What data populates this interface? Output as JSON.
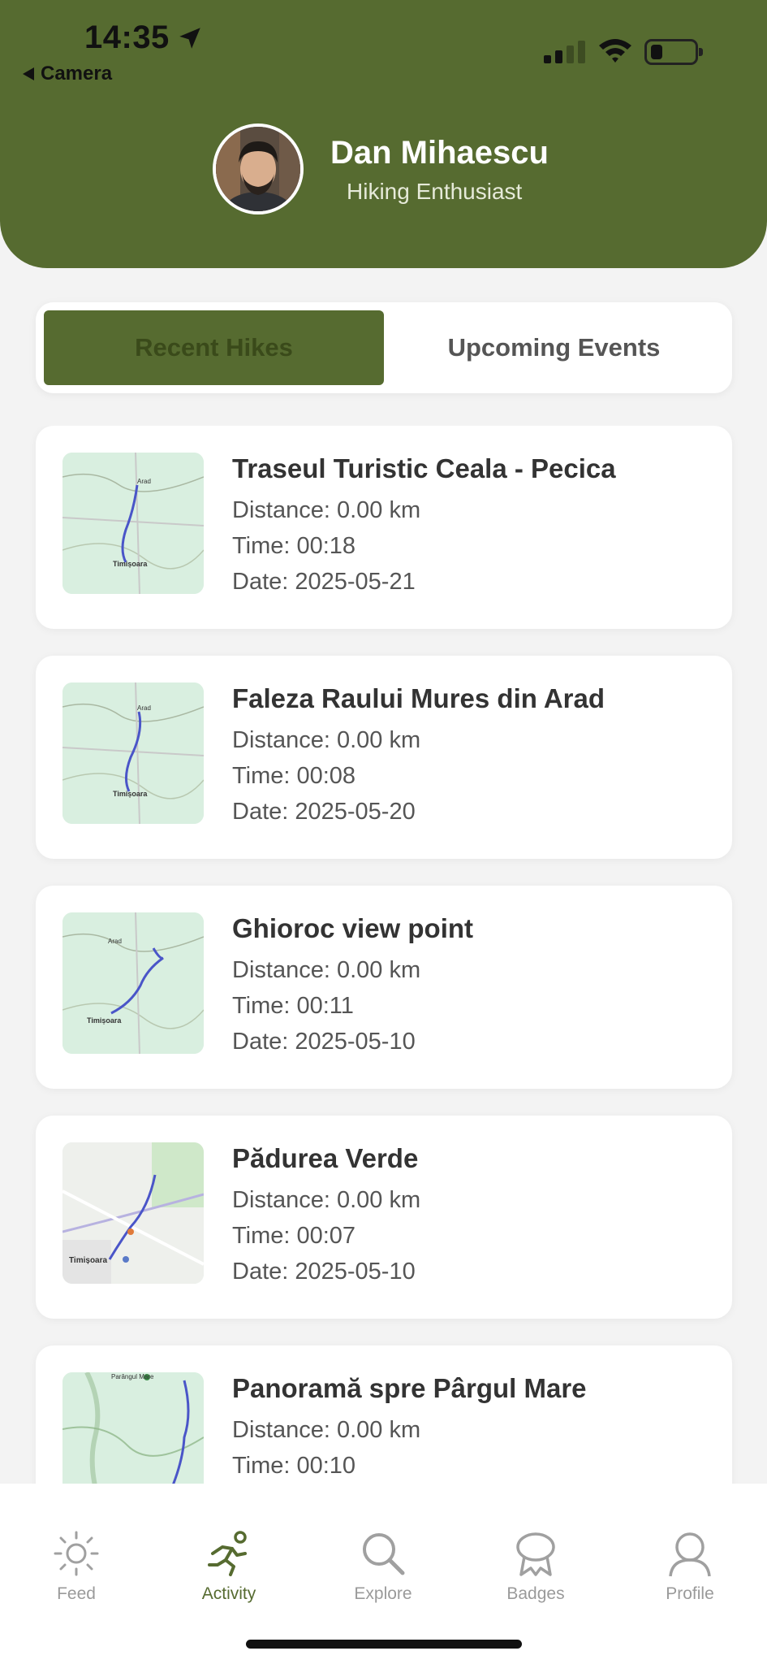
{
  "status_bar": {
    "time": "14:35",
    "back_label": "Camera",
    "location_icon": "location-arrow-icon",
    "signal_icon": "cellular-signal-icon",
    "wifi_icon": "wifi-icon",
    "battery_icon": "battery-icon"
  },
  "profile": {
    "name": "Dan Mihaescu",
    "subtitle": "Hiking Enthusiast",
    "avatar_icon": "user-avatar"
  },
  "tabs": [
    {
      "label": "Recent Hikes",
      "active": true
    },
    {
      "label": "Upcoming Events",
      "active": false
    }
  ],
  "hikes": [
    {
      "title": "Traseul Turistic Ceala - Pecica",
      "distance": "Distance: 0.00 km",
      "time": "Time: 00:18",
      "date": "Date: 2025-05-21"
    },
    {
      "title": "Faleza Raului Mures din Arad",
      "distance": "Distance: 0.00 km",
      "time": "Time: 00:08",
      "date": "Date: 2025-05-20"
    },
    {
      "title": "Ghioroc view point",
      "distance": "Distance: 0.00 km",
      "time": "Time: 00:11",
      "date": "Date: 2025-05-10"
    },
    {
      "title": "Pădurea Verde",
      "distance": "Distance: 0.00 km",
      "time": "Time: 00:07",
      "date": "Date: 2025-05-10"
    },
    {
      "title": "Panoramă spre Pârgul Mare",
      "distance": "Distance: 0.00 km",
      "time": "Time: 00:10",
      "date": ""
    }
  ],
  "map_labels": {
    "map1": [
      "Arad",
      "Timișoara"
    ],
    "map2": [
      "Arad",
      "Timișoara"
    ],
    "map3": [
      "Arad",
      "Timișoara"
    ],
    "map4": [
      "Timișoara"
    ],
    "map5": [
      "Parângul Mare"
    ]
  },
  "nav": [
    {
      "label": "Feed",
      "icon": "sun-icon",
      "active": false
    },
    {
      "label": "Activity",
      "icon": "running-icon",
      "active": true
    },
    {
      "label": "Explore",
      "icon": "search-icon",
      "active": false
    },
    {
      "label": "Badges",
      "icon": "badge-icon",
      "active": false
    },
    {
      "label": "Profile",
      "icon": "person-icon",
      "active": false
    }
  ],
  "colors": {
    "brand": "#566b30",
    "route": "#4a55c8",
    "map_bg": "#d9efe0"
  }
}
